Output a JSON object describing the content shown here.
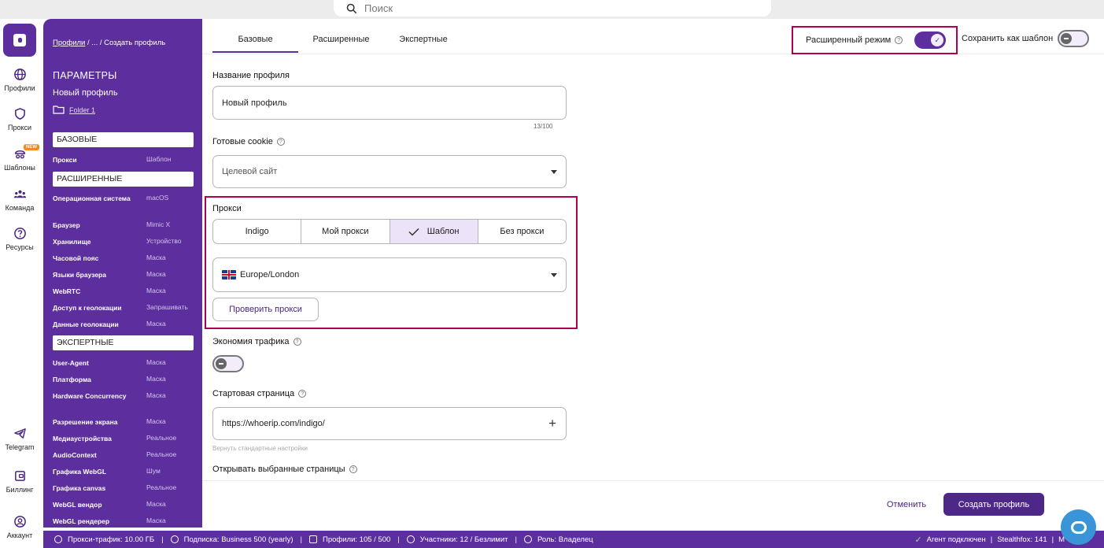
{
  "search": {
    "placeholder": "Поиск"
  },
  "rail": {
    "items": [
      {
        "label": "Профили",
        "icon": "globe-icon"
      },
      {
        "label": "Прокси",
        "icon": "shield-icon"
      },
      {
        "label": "Шаблоны",
        "icon": "templates-icon",
        "badge": "NEW"
      },
      {
        "label": "Команда",
        "icon": "team-icon"
      },
      {
        "label": "Ресурсы",
        "icon": "help-icon"
      }
    ],
    "bottom": [
      {
        "label": "Telegram",
        "icon": "telegram-icon"
      },
      {
        "label": "Биллинг",
        "icon": "wallet-icon"
      },
      {
        "label": "Аккаунт",
        "icon": "account-icon"
      }
    ]
  },
  "sidebar": {
    "breadcrumb_link": "Профили",
    "breadcrumb_rest": " / ... / Создать профиль",
    "title": "ПАРАМЕТРЫ",
    "profile_name": "Новый профиль",
    "folder": "Folder 1",
    "sections": {
      "basic": "БАЗОВЫЕ",
      "advanced": "РАСШИРЕННЫЕ",
      "expert": "ЭКСПЕРТНЫЕ"
    },
    "basic_rows": [
      {
        "label": "Прокси",
        "value": "Шаблон"
      }
    ],
    "advanced_rows": [
      {
        "label": "Операционная система",
        "value": "macOS"
      },
      {
        "label": "Браузер",
        "value": "Mimic X"
      },
      {
        "label": "Хранилище",
        "value": "Устройство"
      },
      {
        "label": "Часовой пояс",
        "value": "Маска"
      },
      {
        "label": "Языки браузера",
        "value": "Маска"
      },
      {
        "label": "WebRTC",
        "value": "Маска"
      },
      {
        "label": "Доступ к геолокации",
        "value": "Запрашивать"
      },
      {
        "label": "Данные геолокации",
        "value": "Маска"
      }
    ],
    "expert_rows": [
      {
        "label": "User-Agent",
        "value": "Маска"
      },
      {
        "label": "Платформа",
        "value": "Маска"
      },
      {
        "label": "Hardware Concurrency",
        "value": "Маска"
      },
      {
        "label": "Разрешение экрана",
        "value": "Маска"
      },
      {
        "label": "Медиаустройства",
        "value": "Реальное"
      },
      {
        "label": "AudioContext",
        "value": "Реальное"
      },
      {
        "label": "Графика WebGL",
        "value": "Шум"
      },
      {
        "label": "Графика canvas",
        "value": "Реальное"
      },
      {
        "label": "WebGL вендор",
        "value": "Маска"
      },
      {
        "label": "WebGL рендерер",
        "value": "Маска"
      }
    ]
  },
  "tabs": [
    "Базовые",
    "Расширенные",
    "Экспертные"
  ],
  "header": {
    "advanced_mode": "Расширенный режим",
    "save_template": "Сохранить как шаблон"
  },
  "form": {
    "profile_name_label": "Название профиля",
    "profile_name_value": "Новый профиль",
    "counter": "13/100",
    "cookie_label": "Готовые cookie",
    "cookie_placeholder": "Целевой сайт",
    "proxy_label": "Прокси",
    "proxy_options": [
      "Indigo",
      "Мой прокси",
      "Шаблон",
      "Без прокси"
    ],
    "proxy_selected": "Шаблон",
    "proxy_template": "Europe/London",
    "check_proxy": "Проверить прокси",
    "traffic_label": "Экономия трафика",
    "start_page_label": "Стартовая страница",
    "start_page_value": "https://whoerip.com/indigo/",
    "reset_defaults": "Вернуть стандартные настройки",
    "open_pages_label": "Открывать выбранные страницы"
  },
  "footer": {
    "cancel": "Отменить",
    "create": "Создать профиль"
  },
  "status_bar": {
    "traffic": "Прокси-трафик: 10.00 ГБ",
    "subscription": "Подписка: Business 500 (yearly)",
    "profiles": "Профили: 105 / 500",
    "members": "Участники: 12 / Безлимит",
    "role": "Роль: Владелец",
    "agent": "Агент подключен",
    "stealthfox": "Stealthfox: 141",
    "mimic": "M"
  },
  "colors": {
    "brand": "#5c2e9e",
    "highlight": "#b00050",
    "chat": "#3a95d8"
  }
}
